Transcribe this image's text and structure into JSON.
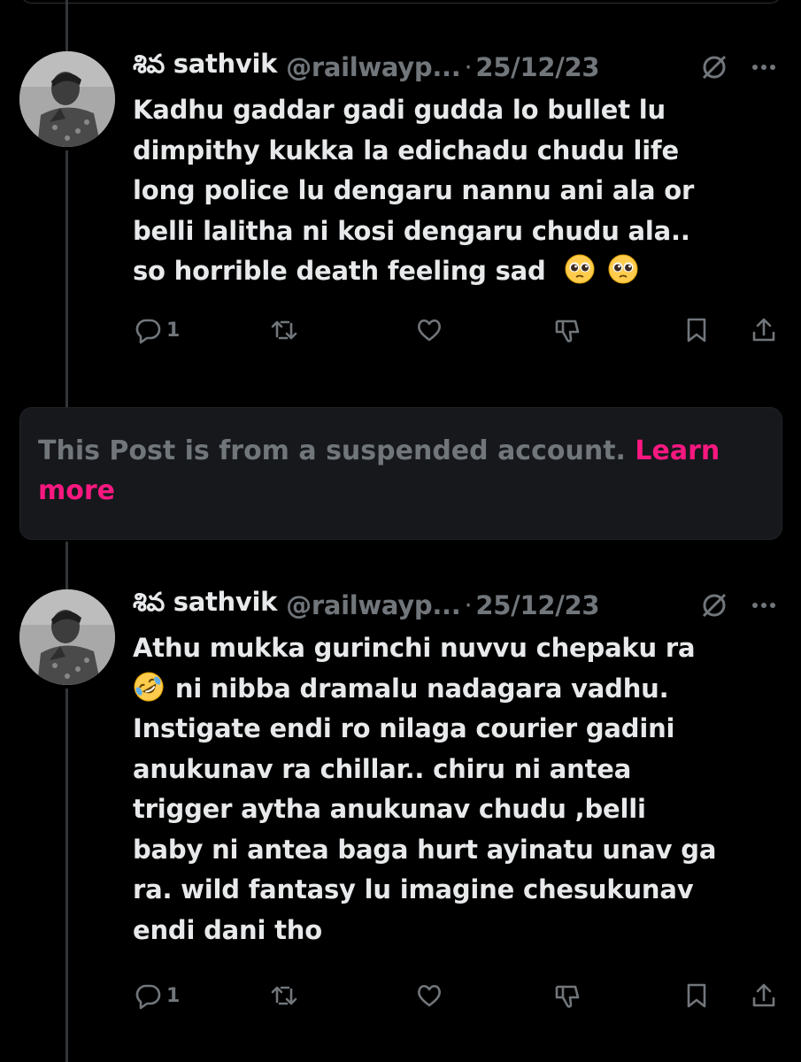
{
  "colors": {
    "background": "#000000",
    "text": "#e7e9ea",
    "muted": "#71767b",
    "accent": "#f91880",
    "card": "#16181c"
  },
  "posts": [
    {
      "display_name": "శివ sathvik",
      "handle": "@railwayp...",
      "separator": "·",
      "date": "25/12/23",
      "lines": [
        "Kadhu gaddar gadi gudda lo bullet lu",
        "dimpithy kukka la edichadu chudu life",
        "long police lu dengaru nannu ani ala or",
        "belli lalitha ni kosi dengaru chudu ala..",
        "so horrible death feeling sad"
      ],
      "emojis": [
        "pleading-face-emoji",
        "pleading-face-emoji"
      ],
      "reply_count": "1"
    },
    {
      "display_name": "శివ sathvik",
      "handle": "@railwayp...",
      "separator": "·",
      "date": "25/12/23",
      "lines": [
        "Athu mukka gurinchi nuvvu chepaku ra",
        " ni nibba dramalu nadagara vadhu.",
        "Instigate endi ro nilaga courier gadini",
        "anukunav ra chillar.. chiru ni antea",
        "trigger aytha anukunav chudu ,belli",
        "baby ni antea baga hurt ayinatu unav ga",
        "ra. wild fantasy lu imagine chesukunav",
        "endi dani tho"
      ],
      "emojis": [
        "rolling-on-floor-laughing-emoji"
      ],
      "reply_count": "1"
    }
  ],
  "suspended_notice": {
    "text": "This Post is from a suspended account.",
    "link": "Learn more"
  },
  "icons": [
    "reply-icon",
    "repost-icon",
    "like-icon",
    "downvote-icon",
    "bookmark-icon",
    "share-icon",
    "grok-icon",
    "more-icon"
  ]
}
